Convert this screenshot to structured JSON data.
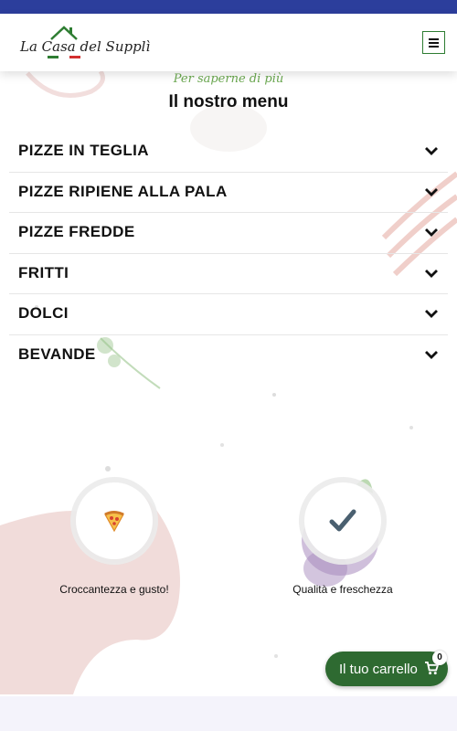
{
  "header": {
    "logo_text": "La Casa del Supplì",
    "menu_icon": "hamburger-icon"
  },
  "section": {
    "subtitle": "Per saperne di più",
    "title": "Il nostro menu"
  },
  "accordion": [
    {
      "label": "PIZZE IN TEGLIA"
    },
    {
      "label": "PIZZE RIPIENE ALLA PALA"
    },
    {
      "label": "PIZZE FREDDE"
    },
    {
      "label": "FRITTI"
    },
    {
      "label": "DOLCI"
    },
    {
      "label": "BEVANDE"
    }
  ],
  "features": [
    {
      "label": "Croccantezza e gusto!",
      "icon": "pizza-slice-icon"
    },
    {
      "label": "Qualità e freschezza",
      "icon": "checkmark-icon"
    }
  ],
  "cart": {
    "label": "Il tuo carrello",
    "count": "0",
    "icon": "shopping-cart-icon"
  },
  "colors": {
    "topbar": "#2c3e9c",
    "accent_green": "#2e6a31",
    "subtitle_green": "#6aa84f",
    "decor_pink": "#ecd0ce"
  }
}
